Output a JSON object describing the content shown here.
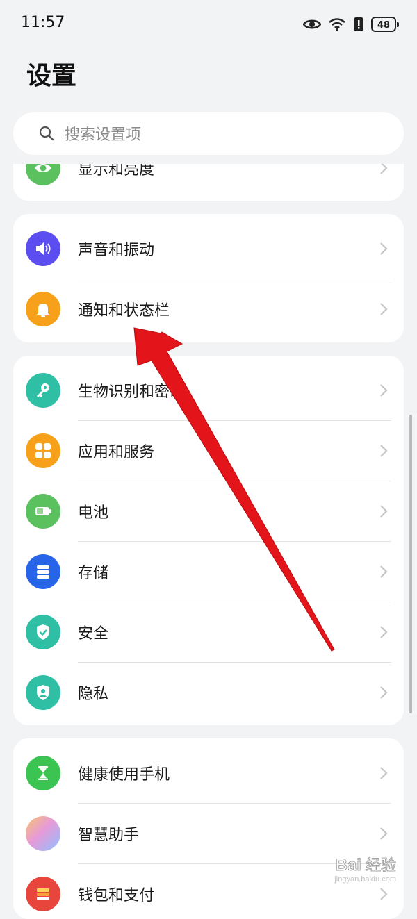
{
  "status_bar": {
    "time": "11:57",
    "battery": "48"
  },
  "header": {
    "title": "设置"
  },
  "search": {
    "placeholder": "搜索设置项"
  },
  "groups": [
    {
      "items": [
        {
          "label": "显示和亮度",
          "icon": "eye-icon",
          "color": "#5bc15e"
        }
      ]
    },
    {
      "items": [
        {
          "label": "声音和振动",
          "icon": "volume-icon",
          "color": "#5b4df0"
        },
        {
          "label": "通知和状态栏",
          "icon": "bell-icon",
          "color": "#f7a11b"
        }
      ]
    },
    {
      "items": [
        {
          "label": "生物识别和密码",
          "icon": "key-icon",
          "color": "#2fbfa5"
        },
        {
          "label": "应用和服务",
          "icon": "apps-icon",
          "color": "#f7a11b"
        },
        {
          "label": "电池",
          "icon": "battery-icon",
          "color": "#5bc15e"
        },
        {
          "label": "存储",
          "icon": "storage-icon",
          "color": "#2764e8"
        },
        {
          "label": "安全",
          "icon": "shield-check-icon",
          "color": "#2fbfa5"
        },
        {
          "label": "隐私",
          "icon": "privacy-icon",
          "color": "#2fbfa5"
        }
      ]
    },
    {
      "items": [
        {
          "label": "健康使用手机",
          "icon": "hourglass-icon",
          "color": "#3cc453"
        },
        {
          "label": "智慧助手",
          "icon": "assistant-icon",
          "color": "#e79ad8"
        },
        {
          "label": "钱包和支付",
          "icon": "wallet-icon",
          "color": "#e8453c"
        }
      ]
    }
  ],
  "watermark": {
    "logo": "Bai",
    "text": "经验",
    "url": "jingyan.baidu.com"
  }
}
